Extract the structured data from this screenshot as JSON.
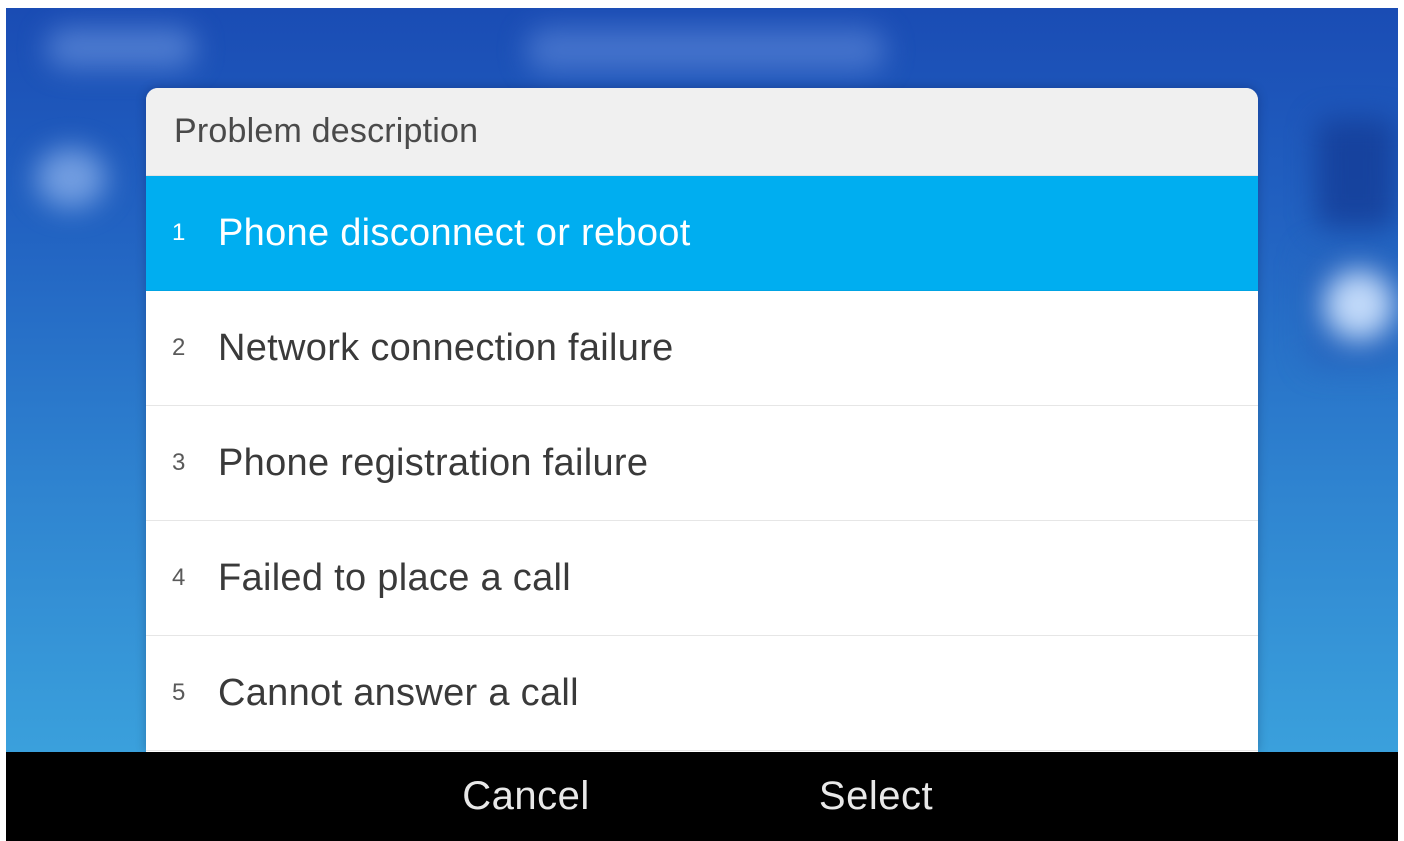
{
  "dialog": {
    "title": "Problem description",
    "selected_index": 0,
    "options": [
      {
        "number": "1",
        "label": "Phone disconnect or reboot"
      },
      {
        "number": "2",
        "label": "Network connection failure"
      },
      {
        "number": "3",
        "label": "Phone registration failure"
      },
      {
        "number": "4",
        "label": "Failed to place a call"
      },
      {
        "number": "5",
        "label": "Cannot answer a call"
      }
    ]
  },
  "softkeys": {
    "cancel_label": "Cancel",
    "select_label": "Select"
  },
  "colors": {
    "selection": "#00aef0",
    "softkey_bar": "#000000",
    "header_background": "#f0f0f0"
  }
}
